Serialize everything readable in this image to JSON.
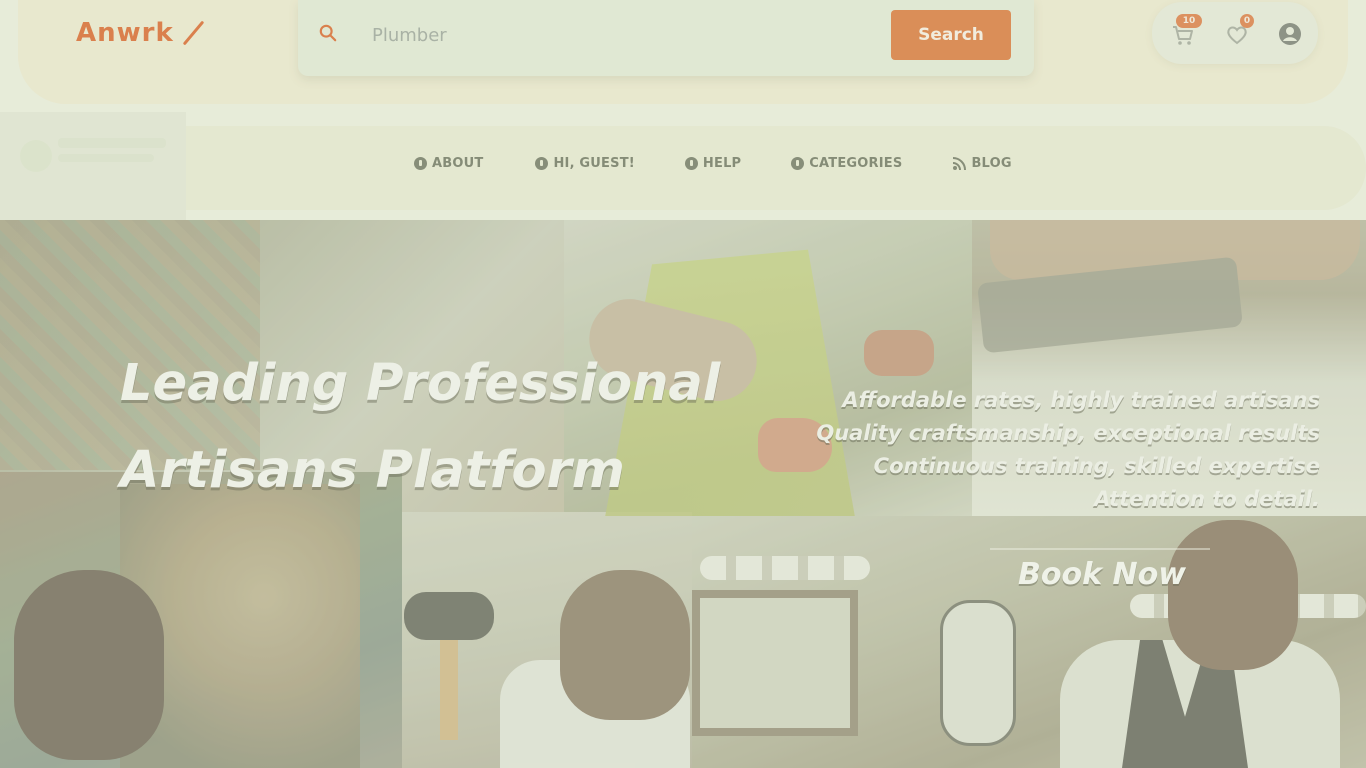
{
  "brand": {
    "name": "Anwrk"
  },
  "search": {
    "value": "",
    "placeholder": "Plumber",
    "button_label": "Search"
  },
  "header_icons": {
    "cart": {
      "icon": "cart-icon",
      "badge": "10"
    },
    "wishlist": {
      "icon": "heart-icon",
      "badge": "0"
    },
    "account": {
      "icon": "user-icon"
    }
  },
  "nav": {
    "items": [
      {
        "label": "ABOUT",
        "icon": "info-icon"
      },
      {
        "label": "HI, GUEST!",
        "icon": "user-icon"
      },
      {
        "label": "HELP",
        "icon": "help-icon"
      },
      {
        "label": "CATEGORIES",
        "icon": "categories-icon"
      },
      {
        "label": "BLOG",
        "icon": "blog-icon"
      }
    ]
  },
  "hero": {
    "title_line1": "Leading Professional",
    "title_line2": "Artisans Platform",
    "points": [
      "Affordable rates, highly trained artisans",
      "Quality craftsmanship, exceptional results",
      "Continuous training, skilled expertise",
      "Attention to detail."
    ],
    "cta_label": "Book Now"
  },
  "colors": {
    "brand": "#d9692f",
    "search_button": "#d97a3c",
    "nav_text": "#727862"
  }
}
